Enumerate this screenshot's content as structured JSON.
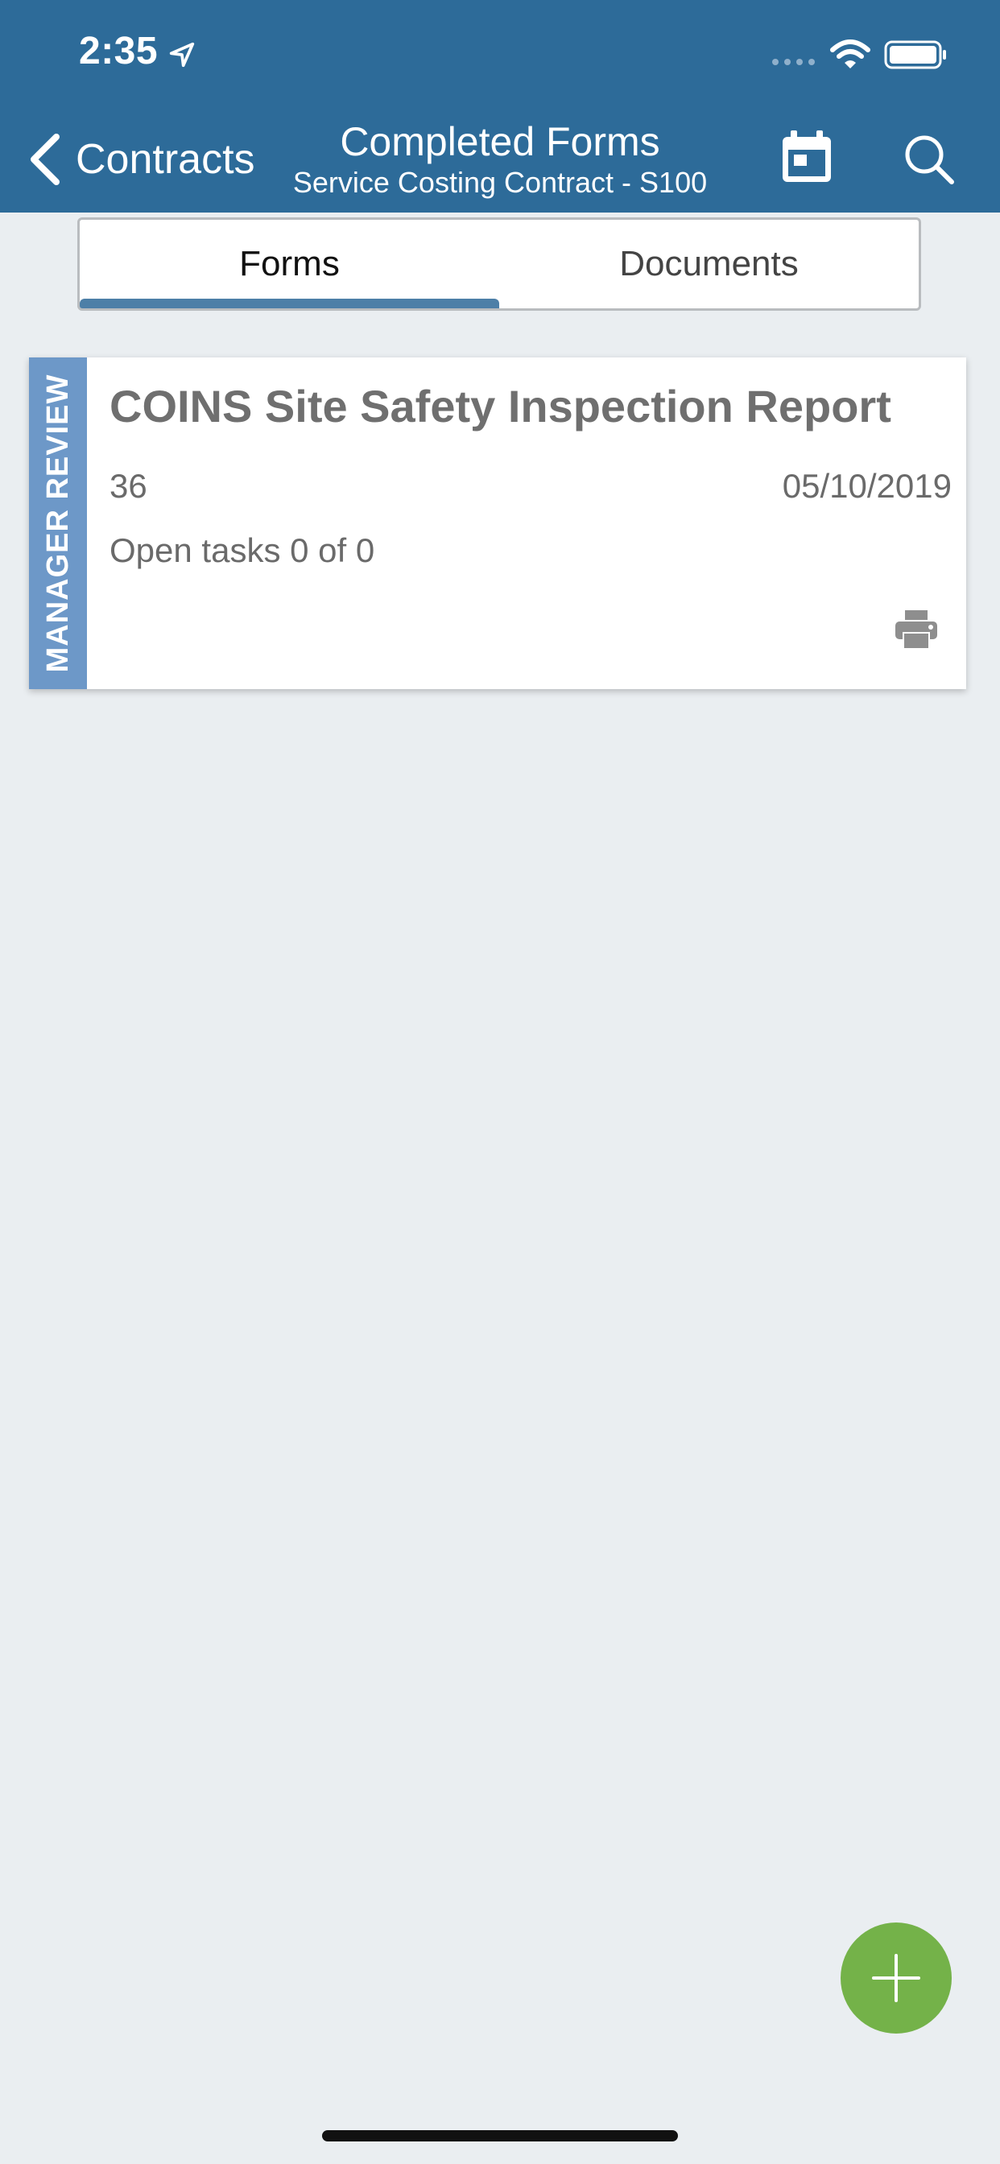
{
  "status_bar": {
    "time": "2:35"
  },
  "nav": {
    "back_label": "Contracts",
    "title": "Completed Forms",
    "subtitle": "Service Costing Contract - S100"
  },
  "tabs": [
    {
      "label": "Forms",
      "selected": true
    },
    {
      "label": "Documents",
      "selected": false
    }
  ],
  "forms": [
    {
      "status": "MANAGER REVIEW",
      "title": "COINS Site Safety Inspection Report",
      "number": "36",
      "date": "05/10/2019",
      "open_tasks": "Open tasks 0 of 0"
    }
  ],
  "colors": {
    "header": "#2d6b99",
    "background": "#eaeef1",
    "status_strip": "#6d98c8",
    "tab_indicator": "#4d7fa7",
    "fab": "#74b249"
  }
}
